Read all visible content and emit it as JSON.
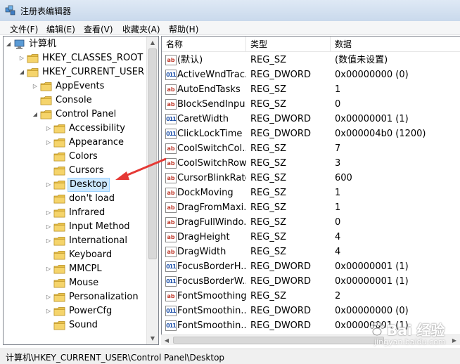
{
  "window": {
    "title": "注册表编辑器"
  },
  "menu": [
    "文件(F)",
    "编辑(E)",
    "查看(V)",
    "收藏夹(A)",
    "帮助(H)"
  ],
  "tree": [
    {
      "label": "计算机",
      "level": 0,
      "expanded": true,
      "icon": "computer-icon"
    },
    {
      "label": "HKEY_CLASSES_ROOT",
      "level": 1,
      "expanded": false
    },
    {
      "label": "HKEY_CURRENT_USER",
      "level": 1,
      "expanded": true
    },
    {
      "label": "AppEvents",
      "level": 2,
      "expanded": false
    },
    {
      "label": "Console",
      "level": 2,
      "expanded": false,
      "leaf": true
    },
    {
      "label": "Control Panel",
      "level": 2,
      "expanded": true
    },
    {
      "label": "Accessibility",
      "level": 3,
      "expanded": false
    },
    {
      "label": "Appearance",
      "level": 3,
      "expanded": false
    },
    {
      "label": "Colors",
      "level": 3,
      "leaf": true
    },
    {
      "label": "Cursors",
      "level": 3,
      "leaf": true
    },
    {
      "label": "Desktop",
      "level": 3,
      "expanded": false,
      "selected": true
    },
    {
      "label": "don't load",
      "level": 3,
      "leaf": true
    },
    {
      "label": "Infrared",
      "level": 3,
      "expanded": false
    },
    {
      "label": "Input Method",
      "level": 3,
      "expanded": false
    },
    {
      "label": "International",
      "level": 3,
      "expanded": false
    },
    {
      "label": "Keyboard",
      "level": 3,
      "leaf": true
    },
    {
      "label": "MMCPL",
      "level": 3,
      "expanded": false
    },
    {
      "label": "Mouse",
      "level": 3,
      "leaf": true
    },
    {
      "label": "Personalization",
      "level": 3,
      "expanded": false
    },
    {
      "label": "PowerCfg",
      "level": 3,
      "expanded": false
    },
    {
      "label": "Sound",
      "level": 3,
      "leaf": true
    }
  ],
  "columns": {
    "name": "名称",
    "type": "类型",
    "data": "数据"
  },
  "values": [
    {
      "name": "(默认)",
      "type": "REG_SZ",
      "data": "(数值未设置)",
      "kind": "sz"
    },
    {
      "name": "ActiveWndTrac...",
      "type": "REG_DWORD",
      "data": "0x00000000 (0)",
      "kind": "dw"
    },
    {
      "name": "AutoEndTasks",
      "type": "REG_SZ",
      "data": "1",
      "kind": "sz"
    },
    {
      "name": "BlockSendInpu...",
      "type": "REG_SZ",
      "data": "0",
      "kind": "sz"
    },
    {
      "name": "CaretWidth",
      "type": "REG_DWORD",
      "data": "0x00000001 (1)",
      "kind": "dw"
    },
    {
      "name": "ClickLockTime",
      "type": "REG_DWORD",
      "data": "0x000004b0 (1200)",
      "kind": "dw"
    },
    {
      "name": "CoolSwitchCol...",
      "type": "REG_SZ",
      "data": "7",
      "kind": "sz"
    },
    {
      "name": "CoolSwitchRows",
      "type": "REG_SZ",
      "data": "3",
      "kind": "sz"
    },
    {
      "name": "CursorBlinkRate",
      "type": "REG_SZ",
      "data": "600",
      "kind": "sz"
    },
    {
      "name": "DockMoving",
      "type": "REG_SZ",
      "data": "1",
      "kind": "sz"
    },
    {
      "name": "DragFromMaxi...",
      "type": "REG_SZ",
      "data": "1",
      "kind": "sz"
    },
    {
      "name": "DragFullWindo...",
      "type": "REG_SZ",
      "data": "0",
      "kind": "sz"
    },
    {
      "name": "DragHeight",
      "type": "REG_SZ",
      "data": "4",
      "kind": "sz"
    },
    {
      "name": "DragWidth",
      "type": "REG_SZ",
      "data": "4",
      "kind": "sz"
    },
    {
      "name": "FocusBorderH...",
      "type": "REG_DWORD",
      "data": "0x00000001 (1)",
      "kind": "dw"
    },
    {
      "name": "FocusBorderW...",
      "type": "REG_DWORD",
      "data": "0x00000001 (1)",
      "kind": "dw"
    },
    {
      "name": "FontSmoothing",
      "type": "REG_SZ",
      "data": "2",
      "kind": "sz"
    },
    {
      "name": "FontSmoothin...",
      "type": "REG_DWORD",
      "data": "0x00000000 (0)",
      "kind": "dw"
    },
    {
      "name": "FontSmoothin...",
      "type": "REG_DWORD",
      "data": "0x00000001 (1)",
      "kind": "dw"
    }
  ],
  "value_icons": {
    "sz": "ab",
    "dw": "011"
  },
  "statusbar": {
    "path": "计算机\\HKEY_CURRENT_USER\\Control Panel\\Desktop"
  },
  "watermark": {
    "brand": "Bai 经验",
    "url": "jingyan.baidu.com"
  },
  "colors": {
    "selection": "#cce8ff",
    "arrow": "#e53935",
    "folder": "#e8c14a"
  }
}
